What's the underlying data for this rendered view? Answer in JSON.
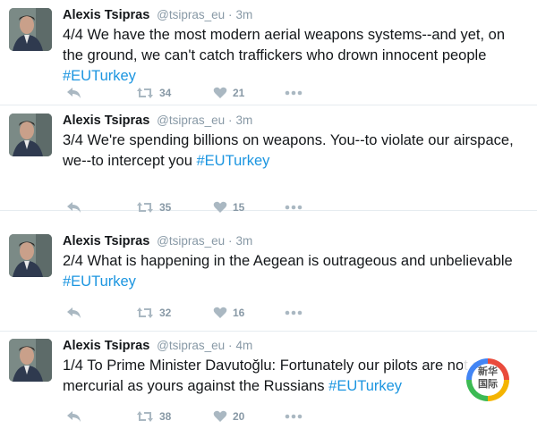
{
  "tweets": [
    {
      "author": "Alexis Tsipras",
      "handle": "@tsipras_eu",
      "separator": "·",
      "time": "3m",
      "text_line1": "4/4 We have the most modern aerial weapons systems--and yet, on",
      "text_line2": "the ground, we can't catch traffickers who drown innocent people",
      "hashtag": "#EUTurkey",
      "retweets": "34",
      "likes": "21"
    },
    {
      "author": "Alexis Tsipras",
      "handle": "@tsipras_eu",
      "separator": "·",
      "time": "3m",
      "text_line1": "3/4 We're spending billions on weapons. You--to violate our airspace,",
      "text_line2": "we--to intercept you",
      "hashtag": "#EUTurkey",
      "retweets": "35",
      "likes": "15"
    },
    {
      "author": "Alexis Tsipras",
      "handle": "@tsipras_eu",
      "separator": "·",
      "time": "3m",
      "text_line1": "2/4 What is happening in the Aegean is outrageous and unbelievable",
      "text_line2": "",
      "hashtag": "#EUTurkey",
      "retweets": "32",
      "likes": "16"
    },
    {
      "author": "Alexis Tsipras",
      "handle": "@tsipras_eu",
      "separator": "·",
      "time": "4m",
      "text_line1": "1/4 To Prime Minister Davutoğlu: Fortunately our pilots are not as",
      "text_line2": "mercurial as yours against the Russians",
      "hashtag": "#EUTurkey",
      "retweets": "38",
      "likes": "20"
    }
  ],
  "watermark": {
    "line1": "新华",
    "line2": "国际"
  },
  "colors": {
    "hashtag": "#1b95e0",
    "meta": "#8899a6",
    "icon": "#aab8c2"
  }
}
